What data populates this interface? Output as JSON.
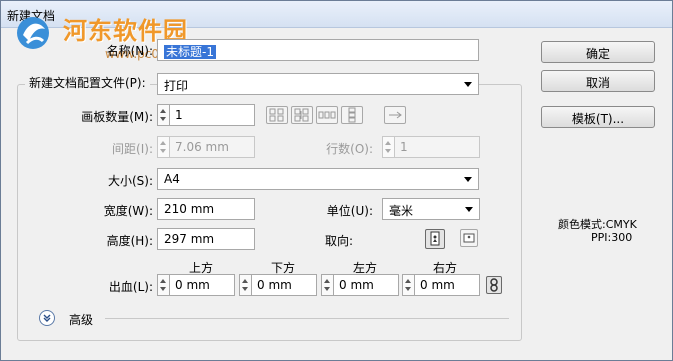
{
  "window": {
    "title": "新建文档"
  },
  "watermark": {
    "site": "河东软件园",
    "url": "www.pc0359.cn"
  },
  "fields": {
    "name_label": "名称(N):",
    "name_value": "未标题-1",
    "profile_label": "新建文档配置文件(P):",
    "profile_value": "打印",
    "artboards_label": "画板数量(M):",
    "artboards_value": "1",
    "spacing_label": "间距(I):",
    "spacing_value": "7.06 mm",
    "rows_label": "行数(O):",
    "rows_value": "1",
    "size_label": "大小(S):",
    "size_value": "A4",
    "width_label": "宽度(W):",
    "width_value": "210 mm",
    "unit_label": "单位(U):",
    "unit_value": "毫米",
    "height_label": "高度(H):",
    "height_value": "297 mm",
    "orientation_label": "取向:",
    "bleed_label": "出血(L):",
    "bleed_top_label": "上方",
    "bleed_bottom_label": "下方",
    "bleed_left_label": "左方",
    "bleed_right_label": "右方",
    "bleed_top_value": "0 mm",
    "bleed_bottom_value": "0 mm",
    "bleed_left_value": "0 mm",
    "bleed_right_value": "0 mm",
    "advanced_label": "高级"
  },
  "buttons": {
    "ok": "确定",
    "cancel": "取消",
    "templates": "模板(T)..."
  },
  "info": {
    "color_mode": "颜色模式:CMYK",
    "ppi": "PPI:300"
  },
  "icons": {
    "artboard_layout": [
      "grid-by-row-icon",
      "grid-by-column-icon",
      "arrange-by-row-icon",
      "arrange-by-column-icon",
      "right-to-left-icon"
    ],
    "orientation": [
      "portrait-icon",
      "landscape-icon"
    ],
    "link": "link-icon"
  }
}
